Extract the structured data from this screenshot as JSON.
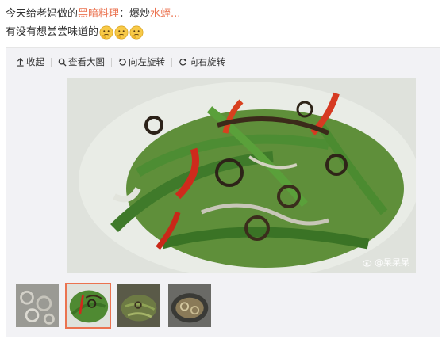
{
  "post": {
    "line1_prefix": "今天给老妈做的",
    "line1_highlight1": "黑暗料理",
    "line1_middle": "：爆炒",
    "line1_highlight2": "水蛭...",
    "line2": "有没有想尝尝味道的"
  },
  "emojis": [
    "thinking-face",
    "thinking-face",
    "thinking-face"
  ],
  "toolbar": {
    "collapse_label": "收起",
    "view_large_label": "查看大图",
    "rotate_left_label": "向左旋转",
    "rotate_right_label": "向右旋转"
  },
  "media": {
    "watermark": "@杲杲杲",
    "thumbnail_count": 4,
    "selected_thumbnail_index": 1
  },
  "colors": {
    "highlight": "#eb7350",
    "panel_bg": "#f2f2f5",
    "active_border": "#eb7350"
  }
}
